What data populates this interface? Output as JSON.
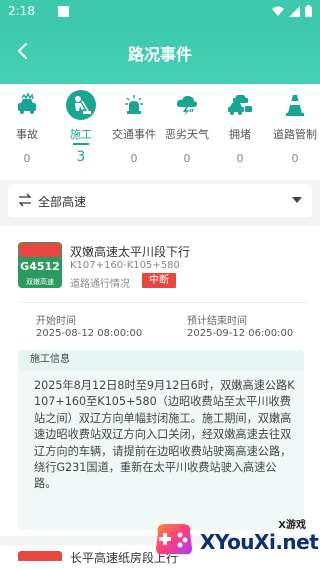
{
  "status": {
    "time": "2:18"
  },
  "header": {
    "title": "路况事件"
  },
  "categories": [
    {
      "label": "事故",
      "count": "0",
      "icon": "car-crash-icon"
    },
    {
      "label": "施工",
      "count": "3",
      "icon": "construction-worker-icon",
      "active": true
    },
    {
      "label": "交通事件",
      "count": "0",
      "icon": "police-light-icon"
    },
    {
      "label": "恶劣天气",
      "count": "0",
      "icon": "storm-icon"
    },
    {
      "label": "拥堵",
      "count": "0",
      "icon": "traffic-jam-icon"
    },
    {
      "label": "道路管制",
      "count": "0",
      "icon": "traffic-cone-icon"
    }
  ],
  "filter": {
    "label": "全部高速"
  },
  "event": {
    "badge_code": "G4512",
    "badge_name": "双嫩高速",
    "title": "双嫩高速太平川段下行",
    "km": "K107+160-K105+580",
    "status_label": "道路通行情况",
    "status": "中断",
    "start_label": "开始时间",
    "start_time": "2025-08-12 08:00:00",
    "end_label": "预计结束时间",
    "end_time": "2025-09-12 06:00:00",
    "info_title": "施工信息",
    "info_body": "2025年8月12日8时至9月12日6时，双嫩高速公路K107+160至K105+580（边昭收费站至太平川收费站之间）双辽方向单幅封闭施工。施工期间，双嫩高速边昭收费站双辽方向入口关闭，经双嫩高速去往双辽方向的车辆，请提前在边昭收费站驶离高速公路，绕行G231国道，重新在太平川收费站驶入高速公路。"
  },
  "next_event": {
    "title": "长平高速纸房段上行"
  },
  "watermark": {
    "small": "X游戏",
    "big": "XYouXi.net"
  },
  "colors": {
    "accent": "#3ec9ad",
    "active": "#1aa591",
    "alert": "#e8463f",
    "badge_green": "#2a9a5e"
  }
}
